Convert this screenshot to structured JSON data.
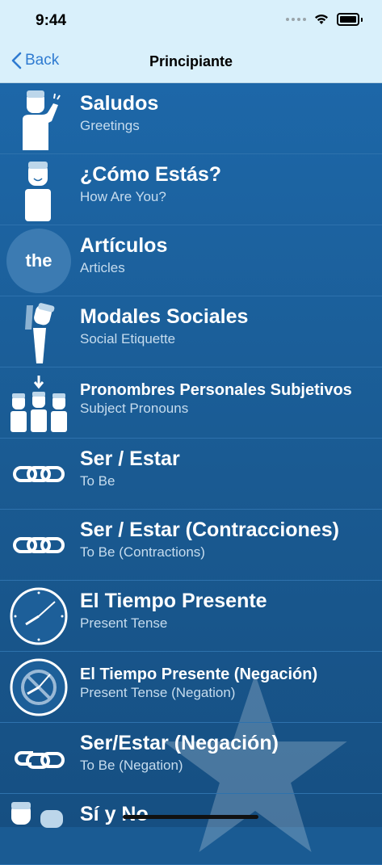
{
  "status": {
    "time": "9:44"
  },
  "nav": {
    "back_label": "Back",
    "title": "Principiante"
  },
  "lessons": [
    {
      "title": "Saludos",
      "subtitle": "Greetings",
      "icon": "person-waving-icon"
    },
    {
      "title": "¿Cómo Estás?",
      "subtitle": "How Are You?",
      "icon": "person-smiling-icon"
    },
    {
      "title": "Artículos",
      "subtitle": "Articles",
      "icon": "article-the-icon",
      "icon_text": "the"
    },
    {
      "title": "Modales Sociales",
      "subtitle": "Social Etiquette",
      "icon": "person-bowing-icon"
    },
    {
      "title": "Pronombres Personales Subjetivos",
      "subtitle": "Subject Pronouns",
      "icon": "three-people-icon"
    },
    {
      "title": "Ser / Estar",
      "subtitle": "To Be",
      "icon": "chain-link-icon"
    },
    {
      "title": "Ser / Estar (Contracciones)",
      "subtitle": "To Be (Contractions)",
      "icon": "chain-link-icon"
    },
    {
      "title": "El Tiempo Presente",
      "subtitle": "Present Tense",
      "icon": "clock-icon"
    },
    {
      "title": "El Tiempo Presente (Negación)",
      "subtitle": "Present Tense (Negation)",
      "icon": "clock-negation-icon"
    },
    {
      "title": "Ser/Estar (Negación)",
      "subtitle": "To Be (Negation)",
      "icon": "broken-chain-icon"
    },
    {
      "title": "Sí y No",
      "subtitle": "",
      "icon": "two-people-icon"
    }
  ]
}
